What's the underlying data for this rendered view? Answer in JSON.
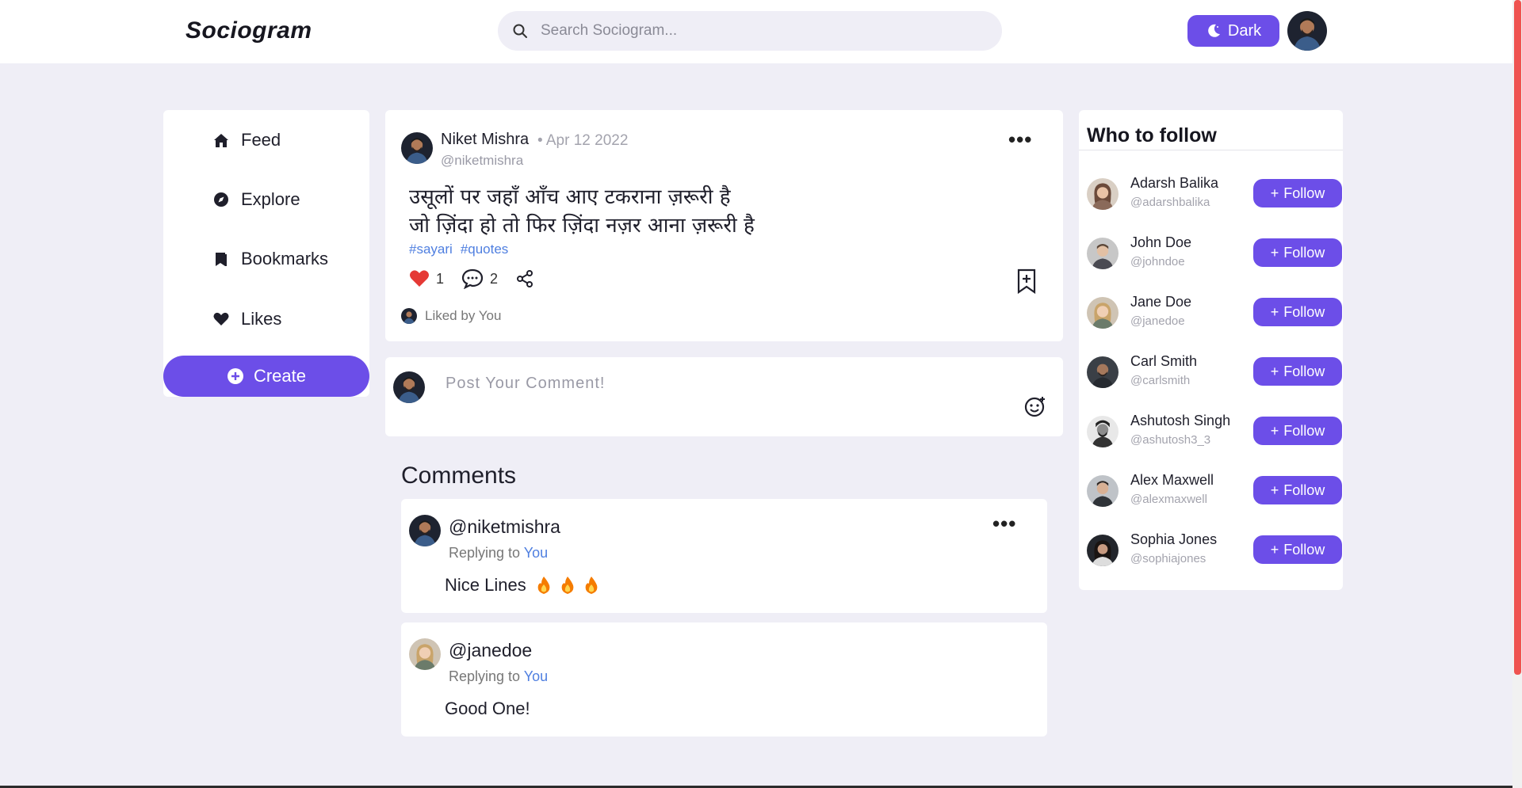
{
  "brand": {
    "logo": "Sociogram",
    "accent": "#6c4ee8",
    "link_color": "#4f7fe0"
  },
  "header": {
    "search_placeholder": "Search Sociogram...",
    "search_icon": "search-icon",
    "theme_button_label": "Dark",
    "theme_icon": "moon-icon"
  },
  "sidebar": {
    "items": [
      {
        "label": "Feed",
        "icon": "home-icon"
      },
      {
        "label": "Explore",
        "icon": "compass-icon"
      },
      {
        "label": "Bookmarks",
        "icon": "bookmark-icon"
      },
      {
        "label": "Likes",
        "icon": "heart-icon"
      }
    ],
    "create_label": "Create"
  },
  "post": {
    "author_name": "Niket Mishra",
    "date": "• Apr 12 2022",
    "author_handle": "@niketmishra",
    "more": "•••",
    "lines": [
      "उसूलों पर जहाँ आँच आए टकराना ज़रूरी है",
      "जो ज़िंदा हो तो फिर ज़िंदा नज़र आना ज़रूरी है"
    ],
    "tags": [
      "#sayari",
      "#quotes"
    ],
    "likes": "1",
    "comments": "2",
    "liked_by": "Liked by You"
  },
  "comment_box": {
    "placeholder": "Post Your Comment!"
  },
  "comments_section": {
    "title": "Comments",
    "items": [
      {
        "handle": "@niketmishra",
        "replying_prefix": "Replying to",
        "replying_to": "You",
        "text": "Nice Lines",
        "more": "•••"
      },
      {
        "handle": "@janedoe",
        "replying_prefix": "Replying to",
        "replying_to": "You",
        "text": "Good One!"
      }
    ]
  },
  "who_to_follow": {
    "title": "Who to follow",
    "button_label": "Follow",
    "users": [
      {
        "name": "Adarsh Balika",
        "handle": "@adarshbalika"
      },
      {
        "name": "John Doe",
        "handle": "@johndoe"
      },
      {
        "name": "Jane Doe",
        "handle": "@janedoe"
      },
      {
        "name": "Carl Smith",
        "handle": "@carlsmith"
      },
      {
        "name": "Ashutosh Singh",
        "handle": "@ashutosh3_3"
      },
      {
        "name": "Alex Maxwell",
        "handle": "@alexmaxwell"
      },
      {
        "name": "Sophia Jones",
        "handle": "@sophiajones"
      }
    ]
  }
}
